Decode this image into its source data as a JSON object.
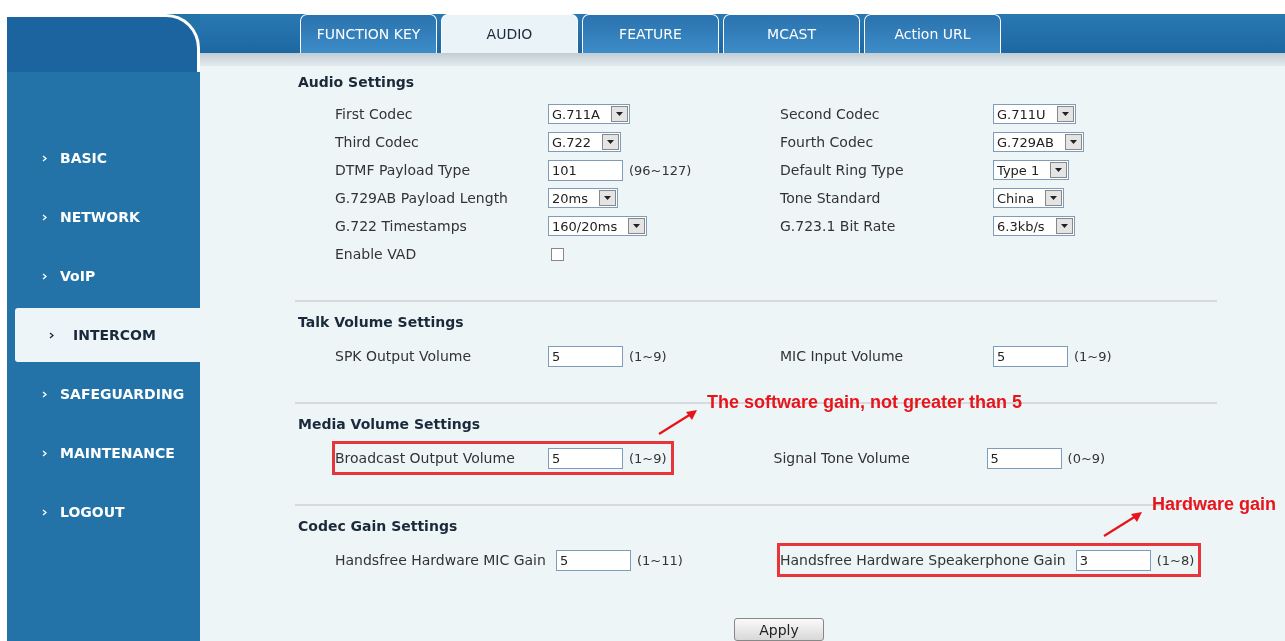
{
  "tabs": [
    {
      "label": "FUNCTION KEY",
      "selected": false
    },
    {
      "label": "AUDIO",
      "selected": true
    },
    {
      "label": "FEATURE",
      "selected": false
    },
    {
      "label": "MCAST",
      "selected": false
    },
    {
      "label": "Action URL",
      "selected": false
    }
  ],
  "sidebar": {
    "items": [
      {
        "label": "BASIC",
        "selected": false
      },
      {
        "label": "NETWORK",
        "selected": false
      },
      {
        "label": "VoIP",
        "selected": false
      },
      {
        "label": "INTERCOM",
        "selected": true
      },
      {
        "label": "SAFEGUARDING",
        "selected": false
      },
      {
        "label": "MAINTENANCE",
        "selected": false
      },
      {
        "label": "LOGOUT",
        "selected": false
      }
    ]
  },
  "sections": [
    {
      "title": "Audio Settings",
      "rows": [
        [
          {
            "label": "First Codec",
            "kind": "select",
            "value": "G.711A"
          },
          {
            "label": "Second Codec",
            "kind": "select",
            "value": "G.711U"
          }
        ],
        [
          {
            "label": "Third Codec",
            "kind": "select",
            "value": "G.722"
          },
          {
            "label": "Fourth Codec",
            "kind": "select",
            "value": "G.729AB"
          }
        ],
        [
          {
            "label": "DTMF Payload Type",
            "kind": "text",
            "value": "101",
            "range": "(96~127)"
          },
          {
            "label": "Default Ring Type",
            "kind": "select",
            "value": "Type 1"
          }
        ],
        [
          {
            "label": "G.729AB Payload Length",
            "kind": "select",
            "value": "20ms"
          },
          {
            "label": "Tone Standard",
            "kind": "select",
            "value": "China"
          }
        ],
        [
          {
            "label": "G.722 Timestamps",
            "kind": "select",
            "value": "160/20ms"
          },
          {
            "label": "G.723.1 Bit Rate",
            "kind": "select",
            "value": "6.3kb/s"
          }
        ],
        [
          {
            "label": "Enable VAD",
            "kind": "checkbox",
            "checked": false
          }
        ]
      ]
    },
    {
      "title": "Talk Volume Settings",
      "rows": [
        [
          {
            "label": "SPK Output Volume",
            "kind": "text",
            "value": "5",
            "range": "(1~9)"
          },
          {
            "label": "MIC Input Volume",
            "kind": "text",
            "value": "5",
            "range": "(1~9)"
          }
        ]
      ]
    },
    {
      "title": "Media Volume Settings",
      "rows": [
        [
          {
            "label": "Broadcast Output Volume",
            "kind": "text",
            "value": "5",
            "range": "(1~9)",
            "highlighted": true,
            "annotation": "The software gain, not greater than 5"
          },
          {
            "label": "Signal Tone Volume",
            "kind": "text",
            "value": "5",
            "range": "(0~9)"
          }
        ]
      ]
    },
    {
      "title": "Codec Gain Settings",
      "rows": [
        [
          {
            "label": "Handsfree Hardware MIC Gain",
            "kind": "text",
            "value": "5",
            "range": "(1~11)"
          },
          {
            "label": "Handsfree Hardware Speakerphone Gain",
            "kind": "text",
            "value": "3",
            "range": "(1~8)",
            "highlighted": true,
            "annotation": "Hardware gain"
          }
        ]
      ]
    }
  ],
  "apply_button": "Apply"
}
